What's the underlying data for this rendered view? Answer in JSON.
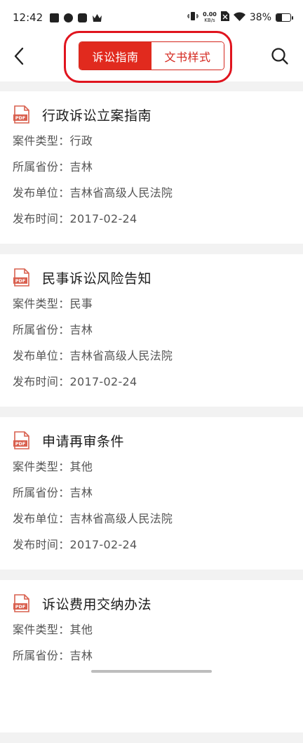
{
  "status_bar": {
    "time": "12:42",
    "net_speed_value": "0.00",
    "net_speed_unit": "KB/s",
    "battery": "38%",
    "battery_level": 0.38
  },
  "header": {
    "tabs": [
      {
        "label": "诉讼指南",
        "active": true
      },
      {
        "label": "文书样式",
        "active": false
      }
    ],
    "accent_color": "#e12a1e"
  },
  "field_labels": {
    "type": "案件类型：",
    "province": "所属省份：",
    "publisher": "发布单位：",
    "date": "发布时间："
  },
  "items": [
    {
      "title": "行政诉讼立案指南",
      "type": "行政",
      "province": "吉林",
      "publisher": "吉林省高级人民法院",
      "date": "2017-02-24"
    },
    {
      "title": "民事诉讼风险告知",
      "type": "民事",
      "province": "吉林",
      "publisher": "吉林省高级人民法院",
      "date": "2017-02-24"
    },
    {
      "title": "申请再审条件",
      "type": "其他",
      "province": "吉林",
      "publisher": "吉林省高级人民法院",
      "date": "2017-02-24"
    },
    {
      "title": "诉讼费用交纳办法",
      "type": "其他",
      "province": "吉林",
      "publisher": "",
      "date": ""
    }
  ],
  "pdf_badge": "PDF"
}
